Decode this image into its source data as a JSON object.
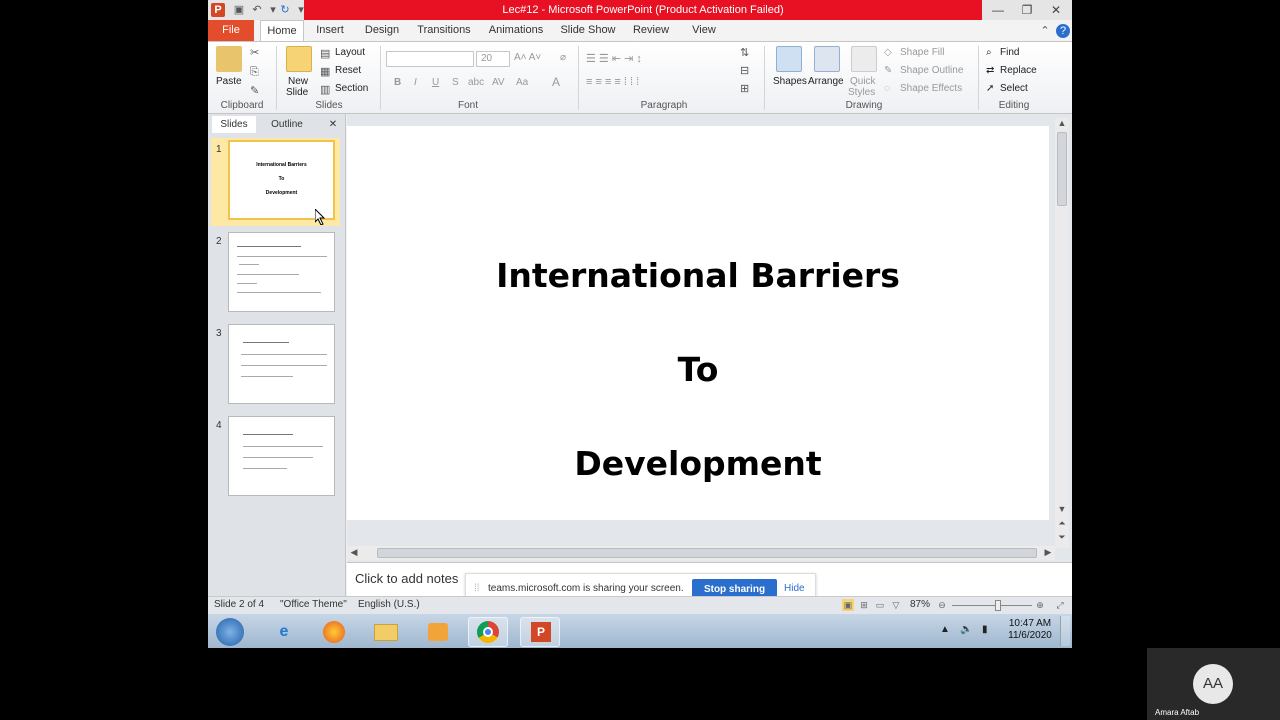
{
  "window": {
    "title": "Lec#12  -  Microsoft PowerPoint (Product Activation Failed)",
    "app_logo": "P"
  },
  "ribbon": {
    "tabs": [
      "File",
      "Home",
      "Insert",
      "Design",
      "Transitions",
      "Animations",
      "Slide Show",
      "Review",
      "View"
    ],
    "active_tab": "Home",
    "clipboard": {
      "paste": "Paste",
      "label": "Clipboard"
    },
    "slides": {
      "new_slide_1": "New",
      "new_slide_2": "Slide",
      "layout": "Layout",
      "reset": "Reset",
      "section": "Section",
      "label": "Slides"
    },
    "font": {
      "size": "20",
      "label": "Font"
    },
    "paragraph": {
      "label": "Paragraph"
    },
    "drawing": {
      "shapes": "Shapes",
      "arrange": "Arrange",
      "quick_1": "Quick",
      "quick_2": "Styles",
      "shape_fill": "Shape Fill",
      "shape_outline": "Shape Outline",
      "shape_effects": "Shape Effects",
      "label": "Drawing"
    },
    "editing": {
      "find": "Find",
      "replace": "Replace",
      "select": "Select",
      "label": "Editing"
    }
  },
  "panel": {
    "tabs": [
      "Slides",
      "Outline"
    ],
    "thumbnails": [
      {
        "number": "1",
        "lines": [
          "International Barriers",
          "To",
          "Development"
        ]
      },
      {
        "number": "2"
      },
      {
        "number": "3"
      },
      {
        "number": "4"
      }
    ]
  },
  "slide": {
    "lines": [
      "International Barriers",
      "To",
      "Development"
    ]
  },
  "notes": {
    "placeholder": "Click to add notes"
  },
  "sharing": {
    "message": "teams.microsoft.com is sharing your screen.",
    "stop": "Stop sharing",
    "hide": "Hide"
  },
  "status": {
    "slide_info": "Slide 2 of 4",
    "theme": "\"Office Theme\"",
    "language": "English (U.S.)",
    "zoom": "87%",
    "zoom_fraction": 0.58
  },
  "taskbar": {
    "time": "10:47 AM",
    "date": "11/6/2020"
  },
  "presenter": {
    "initials": "AA",
    "name": "Amara Aftab"
  },
  "colors": {
    "title_bar_alert": "#e81123",
    "file_tab": "#e44d2b",
    "accent_blue": "#2b6fce",
    "selection": "#f3c24b"
  }
}
